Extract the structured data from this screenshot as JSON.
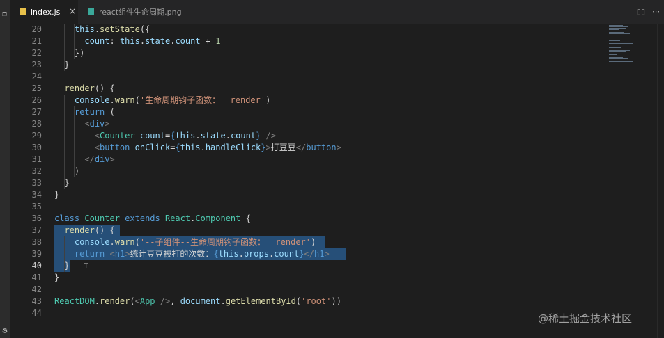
{
  "tabs": [
    {
      "label": "index.js",
      "active": true,
      "icon": "js-file-icon",
      "close": "×"
    },
    {
      "label": "react组件生命周期.png",
      "active": false,
      "icon": "image-file-icon"
    }
  ],
  "actions": {
    "split": "split-editor-icon",
    "more": "more-icon"
  },
  "lines": [
    {
      "n": "20",
      "tokens": [
        [
          "p",
          "    "
        ],
        [
          "v",
          "this"
        ],
        [
          "p",
          "."
        ],
        [
          "f",
          "setState"
        ],
        [
          "p",
          "({"
        ]
      ]
    },
    {
      "n": "21",
      "tokens": [
        [
          "p",
          "      "
        ],
        [
          "v",
          "count"
        ],
        [
          "p",
          ": "
        ],
        [
          "v",
          "this"
        ],
        [
          "p",
          "."
        ],
        [
          "v",
          "state"
        ],
        [
          "p",
          "."
        ],
        [
          "v",
          "count"
        ],
        [
          "p",
          " + "
        ],
        [
          "n",
          "1"
        ]
      ]
    },
    {
      "n": "22",
      "tokens": [
        [
          "p",
          "    })"
        ]
      ]
    },
    {
      "n": "23",
      "tokens": [
        [
          "p",
          "  }"
        ]
      ]
    },
    {
      "n": "24",
      "tokens": []
    },
    {
      "n": "25",
      "tokens": [
        [
          "p",
          "  "
        ],
        [
          "f",
          "render"
        ],
        [
          "p",
          "() {"
        ]
      ]
    },
    {
      "n": "26",
      "tokens": [
        [
          "p",
          "    "
        ],
        [
          "v",
          "console"
        ],
        [
          "p",
          "."
        ],
        [
          "f",
          "warn"
        ],
        [
          "p",
          "("
        ],
        [
          "s",
          "'生命周期钩子函数：  render'"
        ],
        [
          "p",
          ")"
        ]
      ]
    },
    {
      "n": "27",
      "tokens": [
        [
          "p",
          "    "
        ],
        [
          "k",
          "return"
        ],
        [
          "p",
          " ("
        ]
      ]
    },
    {
      "n": "28",
      "tokens": [
        [
          "p",
          "      "
        ],
        [
          "g",
          "<"
        ],
        [
          "t",
          "div"
        ],
        [
          "g",
          ">"
        ]
      ]
    },
    {
      "n": "29",
      "tokens": [
        [
          "p",
          "        "
        ],
        [
          "g",
          "<"
        ],
        [
          "c",
          "Counter"
        ],
        [
          "p",
          " "
        ],
        [
          "v",
          "count"
        ],
        [
          "p",
          "="
        ],
        [
          "k",
          "{"
        ],
        [
          "v",
          "this"
        ],
        [
          "p",
          "."
        ],
        [
          "v",
          "state"
        ],
        [
          "p",
          "."
        ],
        [
          "v",
          "count"
        ],
        [
          "k",
          "}"
        ],
        [
          "p",
          " "
        ],
        [
          "g",
          "/>"
        ]
      ]
    },
    {
      "n": "30",
      "tokens": [
        [
          "p",
          "        "
        ],
        [
          "g",
          "<"
        ],
        [
          "t",
          "button"
        ],
        [
          "p",
          " "
        ],
        [
          "v",
          "onClick"
        ],
        [
          "p",
          "="
        ],
        [
          "k",
          "{"
        ],
        [
          "v",
          "this"
        ],
        [
          "p",
          "."
        ],
        [
          "v",
          "handleClick"
        ],
        [
          "k",
          "}"
        ],
        [
          "g",
          ">"
        ],
        [
          "p",
          "打豆豆"
        ],
        [
          "g",
          "</"
        ],
        [
          "t",
          "button"
        ],
        [
          "g",
          ">"
        ]
      ]
    },
    {
      "n": "31",
      "tokens": [
        [
          "p",
          "      "
        ],
        [
          "g",
          "</"
        ],
        [
          "t",
          "div"
        ],
        [
          "g",
          ">"
        ]
      ]
    },
    {
      "n": "32",
      "tokens": [
        [
          "p",
          "    )"
        ]
      ]
    },
    {
      "n": "33",
      "tokens": [
        [
          "p",
          "  }"
        ]
      ]
    },
    {
      "n": "34",
      "tokens": [
        [
          "p",
          "}"
        ]
      ]
    },
    {
      "n": "35",
      "tokens": []
    },
    {
      "n": "36",
      "tokens": [
        [
          "k",
          "class"
        ],
        [
          "p",
          " "
        ],
        [
          "c",
          "Counter"
        ],
        [
          "p",
          " "
        ],
        [
          "k",
          "extends"
        ],
        [
          "p",
          " "
        ],
        [
          "c",
          "React"
        ],
        [
          "p",
          "."
        ],
        [
          "c",
          "Component"
        ],
        [
          "p",
          " {"
        ]
      ]
    },
    {
      "n": "37",
      "tokens": [
        [
          "p",
          "  "
        ],
        [
          "f",
          "render"
        ],
        [
          "p",
          "() {"
        ]
      ]
    },
    {
      "n": "38",
      "tokens": [
        [
          "p",
          "    "
        ],
        [
          "v",
          "console"
        ],
        [
          "p",
          "."
        ],
        [
          "f",
          "warn"
        ],
        [
          "p",
          "("
        ],
        [
          "s",
          "'--子组件--生命周期钩子函数：  render'"
        ],
        [
          "p",
          ")"
        ]
      ]
    },
    {
      "n": "39",
      "tokens": [
        [
          "p",
          "    "
        ],
        [
          "k",
          "return"
        ],
        [
          "p",
          " "
        ],
        [
          "g",
          "<"
        ],
        [
          "t",
          "h1"
        ],
        [
          "g",
          ">"
        ],
        [
          "p",
          "统计豆豆被打的次数："
        ],
        [
          "k",
          "{"
        ],
        [
          "v",
          "this"
        ],
        [
          "p",
          "."
        ],
        [
          "v",
          "props"
        ],
        [
          "p",
          "."
        ],
        [
          "v",
          "count"
        ],
        [
          "k",
          "}"
        ],
        [
          "g",
          "</"
        ],
        [
          "t",
          "h1"
        ],
        [
          "g",
          ">"
        ]
      ]
    },
    {
      "n": "40",
      "tokens": [
        [
          "p",
          "  }"
        ]
      ]
    },
    {
      "n": "41",
      "tokens": [
        [
          "p",
          "}"
        ]
      ]
    },
    {
      "n": "42",
      "tokens": []
    },
    {
      "n": "43",
      "tokens": [
        [
          "c",
          "ReactDOM"
        ],
        [
          "p",
          "."
        ],
        [
          "f",
          "render"
        ],
        [
          "p",
          "("
        ],
        [
          "g",
          "<"
        ],
        [
          "c",
          "App"
        ],
        [
          "p",
          " "
        ],
        [
          "g",
          "/>"
        ],
        [
          "p",
          ", "
        ],
        [
          "v",
          "document"
        ],
        [
          "p",
          "."
        ],
        [
          "f",
          "getElementById"
        ],
        [
          "p",
          "("
        ],
        [
          "s",
          "'root'"
        ],
        [
          "p",
          "))"
        ]
      ]
    },
    {
      "n": "44",
      "tokens": []
    }
  ],
  "watermark": "@稀土掘金技术社区",
  "activity_icons": [
    "files-icon",
    "settings-gear-icon"
  ],
  "colors": {
    "background": "#1e1e1e",
    "selection": "#264f78",
    "keyword": "#569cd6",
    "function": "#dcdcaa",
    "variable": "#9cdcfe",
    "string": "#ce9178",
    "class": "#4ec9b0"
  }
}
